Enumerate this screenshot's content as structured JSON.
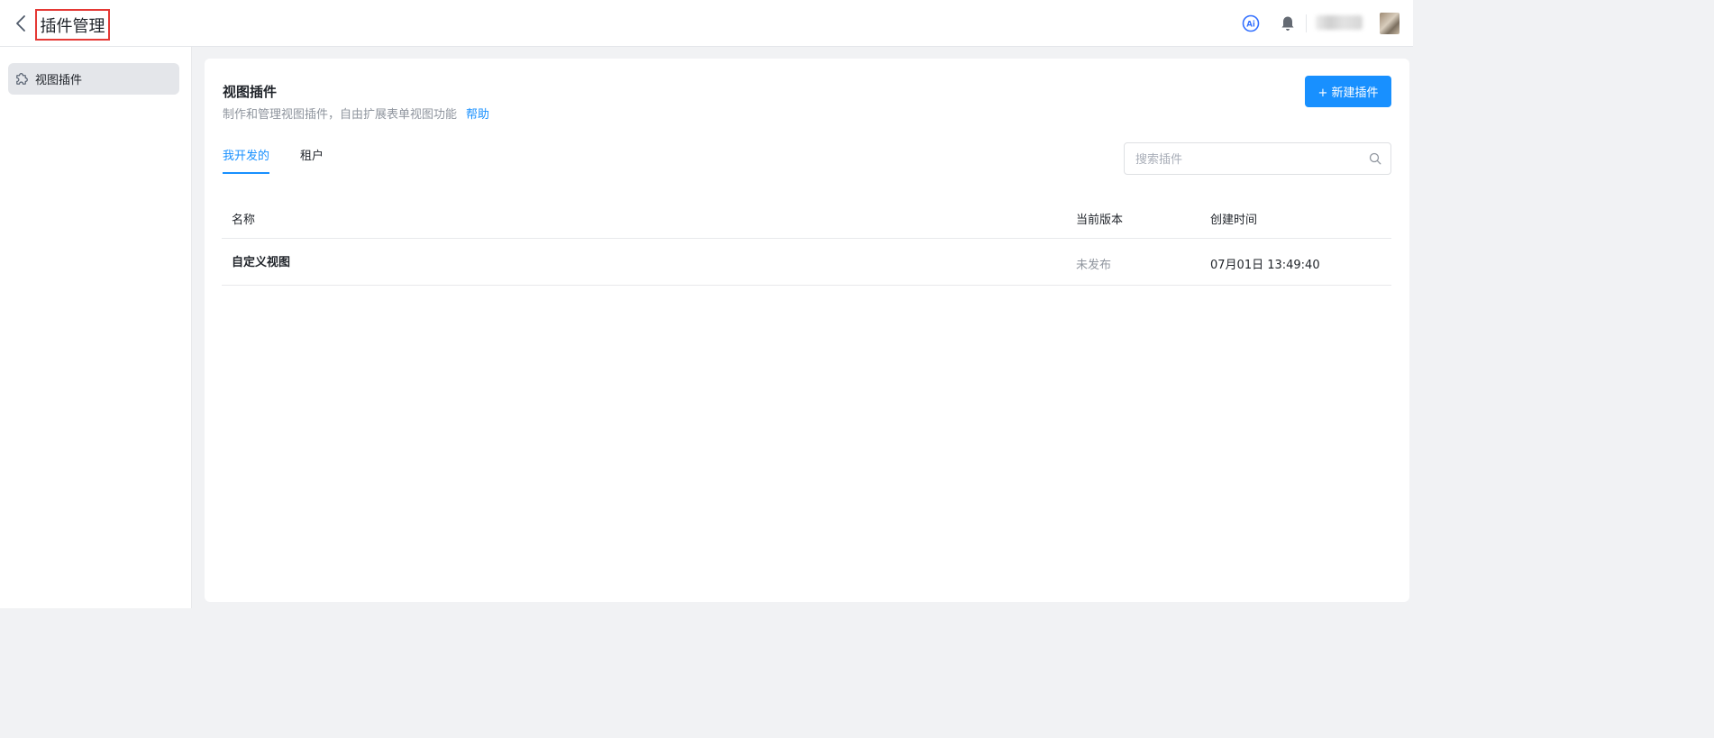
{
  "header": {
    "title": "插件管理",
    "icons": [
      "chevron-left-icon",
      "ai-icon",
      "bell-icon"
    ],
    "ai_badge": "Ai"
  },
  "sidebar": {
    "items": [
      {
        "label": "视图插件",
        "icon": "puzzle-icon",
        "active": true
      }
    ]
  },
  "main": {
    "title": "视图插件",
    "subtitle": "制作和管理视图插件，自由扩展表单视图功能",
    "help_link": "帮助",
    "new_button": "+ 新建插件",
    "tabs": [
      {
        "label": "我开发的",
        "active": true
      },
      {
        "label": "租户",
        "active": false
      }
    ],
    "search": {
      "placeholder": "搜索插件",
      "value": ""
    },
    "table": {
      "columns": [
        "名称",
        "当前版本",
        "创建时间"
      ],
      "rows": [
        {
          "name": "自定义视图",
          "version": "未发布",
          "created": "07月01日 13:49:40"
        }
      ]
    }
  },
  "colors": {
    "accent": "#1890ff",
    "highlight_border": "#e53935",
    "muted_text": "#8f959e",
    "page_bg": "#f1f2f4"
  }
}
